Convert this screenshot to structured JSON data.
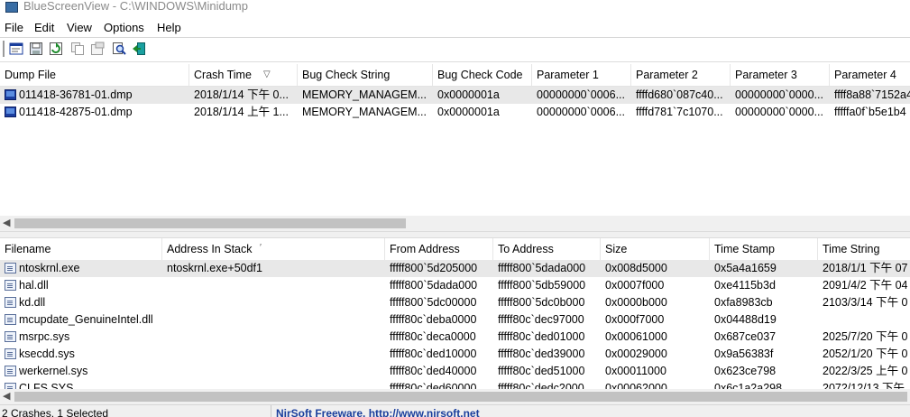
{
  "window": {
    "title": "BlueScreenView  -  C:\\WINDOWS\\Minidump"
  },
  "menu": {
    "file": "File",
    "edit": "Edit",
    "view": "View",
    "options": "Options",
    "help": "Help"
  },
  "toolbar": {
    "icons": [
      "html-report-icon",
      "save-icon",
      "refresh-icon",
      "copy-icon",
      "properties-icon",
      "find-icon",
      "exit-icon"
    ]
  },
  "dumps": {
    "columns": [
      "Dump File",
      "Crash Time",
      "Bug Check String",
      "Bug Check Code",
      "Parameter 1",
      "Parameter 2",
      "Parameter 3",
      "Parameter 4"
    ],
    "sort_indicator": "▽",
    "rows": [
      [
        "011418-36781-01.dmp",
        "2018/1/14 下午 0...",
        "MEMORY_MANAGEM...",
        "0x0000001a",
        "00000000`0006...",
        "ffffd680`087c40...",
        "00000000`0000...",
        "ffff8a88`7152a4"
      ],
      [
        "011418-42875-01.dmp",
        "2018/1/14 上午 1...",
        "MEMORY_MANAGEM...",
        "0x0000001a",
        "00000000`0006...",
        "ffffd781`7c1070...",
        "00000000`0000...",
        "fffffa0f`b5e1b4"
      ]
    ]
  },
  "drivers": {
    "columns": [
      "Filename",
      "Address In Stack",
      "From Address",
      "To Address",
      "Size",
      "Time Stamp",
      "Time String"
    ],
    "sort_indicator": "′",
    "rows": [
      [
        "ntoskrnl.exe",
        "ntoskrnl.exe+50df1",
        "fffff800`5d205000",
        "fffff800`5dada000",
        "0x008d5000",
        "0x5a4a1659",
        "2018/1/1 下午 07"
      ],
      [
        "hal.dll",
        "",
        "fffff800`5dada000",
        "fffff800`5db59000",
        "0x0007f000",
        "0xe4115b3d",
        "2091/4/2 下午 04"
      ],
      [
        "kd.dll",
        "",
        "fffff800`5dc00000",
        "fffff800`5dc0b000",
        "0x0000b000",
        "0xfa8983cb",
        "2103/3/14 下午 0"
      ],
      [
        "mcupdate_GenuineIntel.dll",
        "",
        "fffff80c`deba0000",
        "fffff80c`dec97000",
        "0x000f7000",
        "0x04488d19",
        ""
      ],
      [
        "msrpc.sys",
        "",
        "fffff80c`deca0000",
        "fffff80c`ded01000",
        "0x00061000",
        "0x687ce037",
        "2025/7/20 下午 0"
      ],
      [
        "ksecdd.sys",
        "",
        "fffff80c`ded10000",
        "fffff80c`ded39000",
        "0x00029000",
        "0x9a56383f",
        "2052/1/20 下午 0"
      ],
      [
        "werkernel.sys",
        "",
        "fffff80c`ded40000",
        "fffff80c`ded51000",
        "0x00011000",
        "0x623ce798",
        "2022/3/25 上午 0"
      ],
      [
        "CLFS.SYS",
        "",
        "fffff80c`ded60000",
        "fffff80c`dedc2000",
        "0x00062000",
        "0x6c1a2a298",
        "2072/12/13 下午"
      ]
    ]
  },
  "status": {
    "left": "2 Crashes, 1 Selected",
    "right": "NirSoft Freeware.  http://www.nirsoft.net"
  }
}
